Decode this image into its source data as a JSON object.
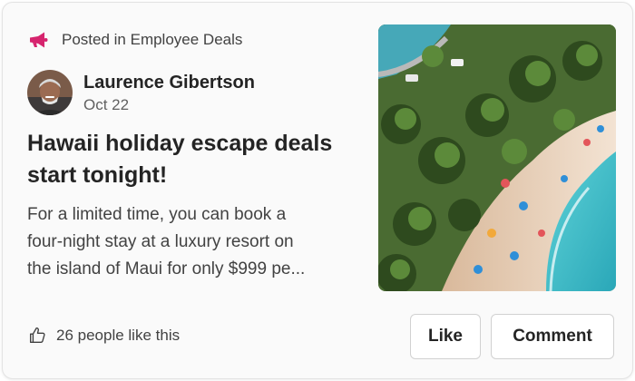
{
  "post": {
    "channel_text": "Posted in Employee Deals",
    "author_name": "Laurence Gibertson",
    "date": "Oct 22",
    "headline_line1": "Hawaii holiday escape deals",
    "headline_line2": "start tonight!",
    "body_lines": [
      "For a limited time, you can book a",
      "four-night stay at a luxury resort on",
      "the island of Maui for only $999 pe..."
    ]
  },
  "footer": {
    "likes_text": "26 people like this",
    "like_label": "Like",
    "comment_label": "Comment"
  },
  "icons": {
    "channel": "megaphone-icon",
    "likes": "thumbs-up-icon"
  },
  "colors": {
    "accent": "#d6246e"
  }
}
